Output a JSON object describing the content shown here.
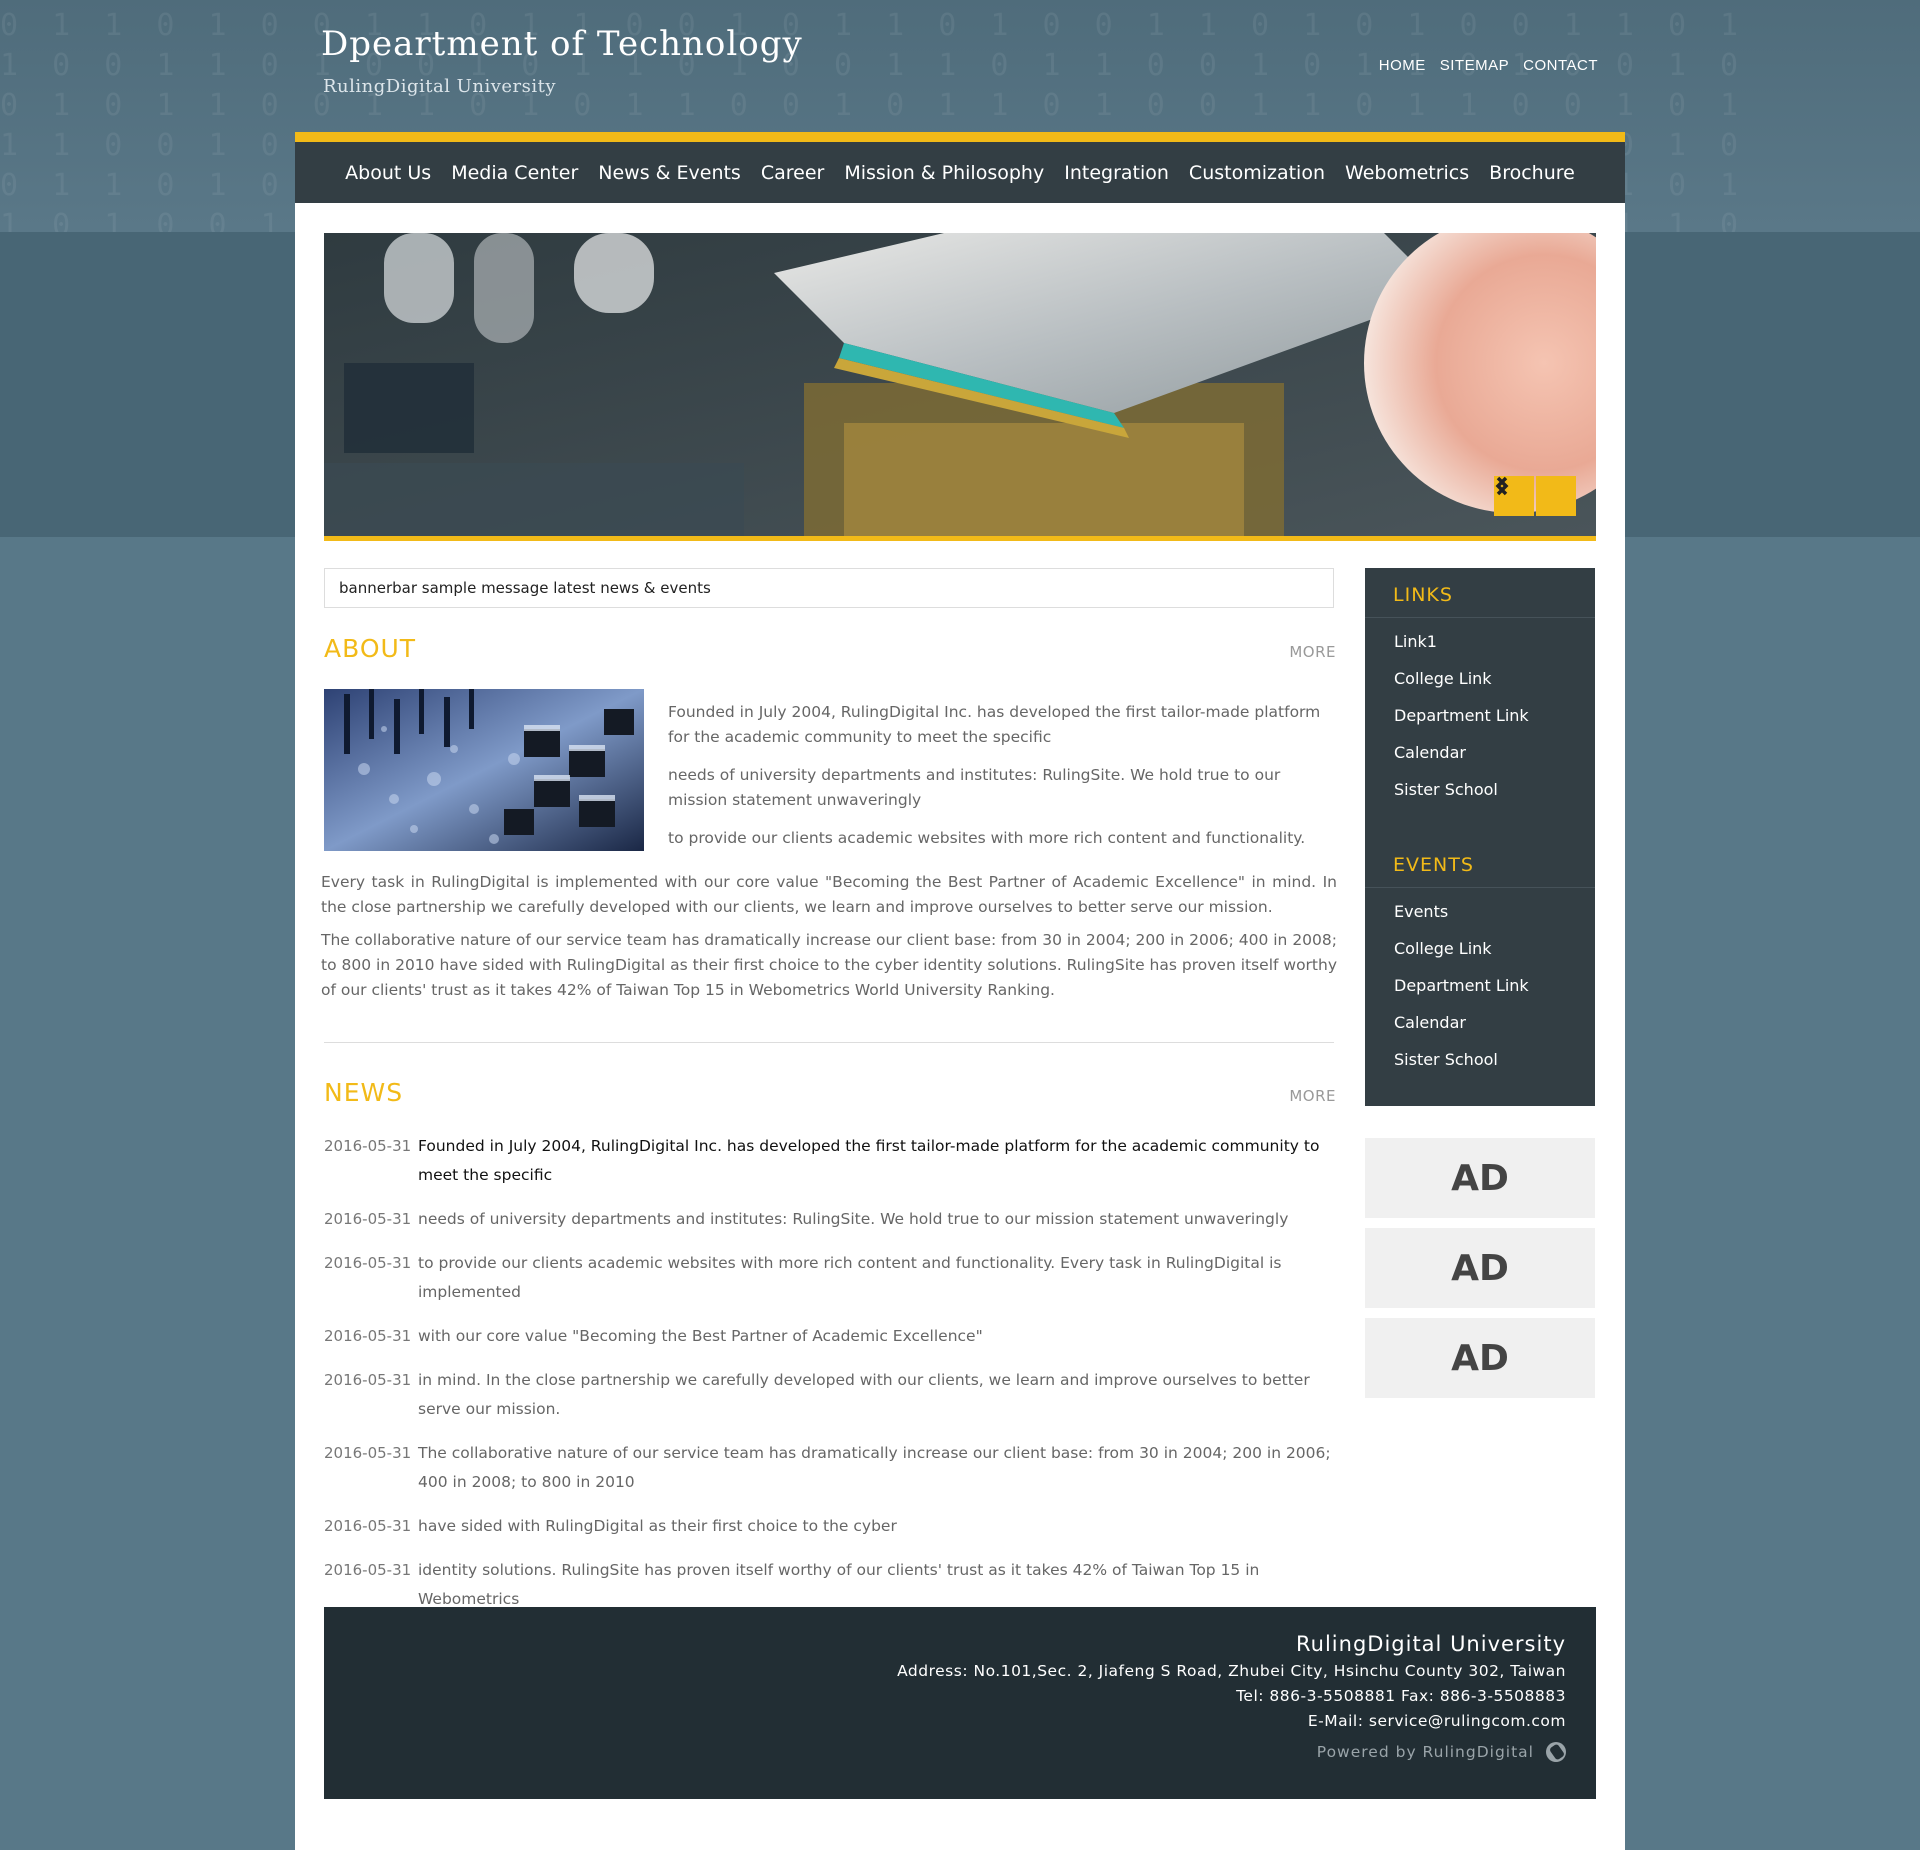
{
  "header": {
    "title": "Dpeartment of Technology",
    "subtitle": "RulingDigital University",
    "top_links": [
      "HOME",
      "SITEMAP",
      "CONTACT"
    ]
  },
  "nav": {
    "items": [
      "About Us",
      "Media Center",
      "News & Events",
      "Career",
      "Mission & Philosophy",
      "Integration",
      "Customization",
      "Webometrics",
      "Brochure"
    ]
  },
  "slider": {
    "prev_icon": "chevron-left-icon",
    "next_icon": "chevron-right-icon"
  },
  "bannerbar": {
    "message": "bannerbar sample message latest news & events"
  },
  "about": {
    "title": "ABOUT",
    "more": "MORE",
    "side_paragraphs": [
      "Founded in July 2004, RulingDigital Inc. has developed the first tailor-made platform for the academic community to meet the specific",
      "needs of university departments and institutes: RulingSite. We hold true to our mission statement unwaveringly",
      "to provide our clients academic websites with more rich content and functionality."
    ],
    "full_paragraphs": [
      "Every task in RulingDigital is implemented with our core value \"Becoming the Best Partner of Academic Excellence\"  in mind. In the close partnership we carefully developed with our clients, we learn and improve ourselves to better serve our mission.",
      "The collaborative nature of our service team has dramatically increase our client base: from 30 in 2004; 200 in 2006; 400 in 2008; to 800 in 2010 have sided with RulingDigital as their first choice to the cyber identity solutions. RulingSite has proven itself worthy of our clients' trust as it takes 42% of Taiwan Top 15 in Webometrics World University Ranking."
    ]
  },
  "news": {
    "title": "NEWS",
    "more": "MORE",
    "items": [
      {
        "date": "2016-05-31",
        "text": "Founded in July 2004, RulingDigital Inc. has developed the first tailor-made platform for the academic community to meet the specific"
      },
      {
        "date": "2016-05-31",
        "text": "needs of university departments and institutes: RulingSite. We hold true to our mission statement unwaveringly"
      },
      {
        "date": "2016-05-31",
        "text": "to provide our clients academic websites with more rich content and functionality. Every task in RulingDigital is implemented"
      },
      {
        "date": "2016-05-31",
        "text": "with our core value \"Becoming the Best Partner of Academic Excellence\""
      },
      {
        "date": "2016-05-31",
        "text": " in mind. In the close partnership we carefully developed with our clients, we learn and improve ourselves to better serve our mission."
      },
      {
        "date": "2016-05-31",
        "text": "The collaborative nature of our service team has dramatically increase our client base: from 30 in 2004; 200 in 2006; 400 in 2008; to 800 in 2010"
      },
      {
        "date": "2016-05-31",
        "text": "have sided with RulingDigital as their first choice to the cyber"
      },
      {
        "date": "2016-05-31",
        "text": "identity solutions. RulingSite has proven itself worthy of our clients' trust as it takes 42% of Taiwan Top 15 in Webometrics"
      }
    ]
  },
  "sidebar": {
    "links_title": "LINKS",
    "links": [
      "Link1",
      "College Link",
      "Department Link",
      "Calendar",
      "Sister School"
    ],
    "events_title": "EVENTS",
    "events": [
      "Events",
      "College Link",
      "Department Link",
      "Calendar",
      "Sister School"
    ],
    "ads": [
      "AD",
      "AD",
      "AD"
    ]
  },
  "footer": {
    "name": "RulingDigital University",
    "address": "Address: No.101,Sec. 2, Jiafeng S Road, Zhubei City, Hsinchu County 302, Taiwan",
    "tel": "Tel: 886-3-5508881  Fax: 886-3-5508883",
    "email": "E-Mail: service@rulingcom.com",
    "powered": "Powered by RulingDigital"
  },
  "colors": {
    "accent": "#f2ba18",
    "nav_bg": "#333e44",
    "footer_bg": "#222e34",
    "page_bg": "#557585"
  }
}
